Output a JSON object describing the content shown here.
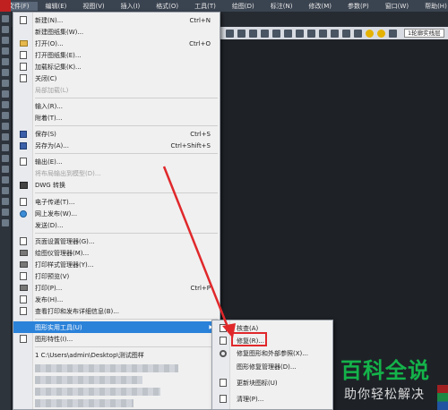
{
  "menubar": {
    "items": [
      "文件(F)",
      "编辑(E)",
      "视图(V)",
      "插入(I)",
      "格式(O)",
      "工具(T)",
      "绘图(D)",
      "标注(N)",
      "修改(M)",
      "参数(P)",
      "窗口(W)",
      "帮助(H)"
    ]
  },
  "toolbar": {
    "linetype_combo": "1轮廓实线层"
  },
  "file_menu": {
    "items": [
      {
        "label": "新建(N)...",
        "shortcut": "Ctrl+N",
        "icon": "new-page-icon"
      },
      {
        "label": "新建图纸集(W)...",
        "shortcut": "",
        "icon": ""
      },
      {
        "label": "打开(O)...",
        "shortcut": "Ctrl+O",
        "icon": "open-folder-icon"
      },
      {
        "label": "打开图纸集(E)...",
        "shortcut": "",
        "icon": "open-sheetset-icon"
      },
      {
        "label": "加载标记集(K)...",
        "shortcut": "",
        "icon": "markup-set-icon"
      },
      {
        "label": "关闭(C)",
        "shortcut": "",
        "icon": "close-file-icon"
      },
      {
        "label": "局部加载(L)",
        "shortcut": "",
        "icon": "",
        "disabled": true
      },
      {
        "label": "输入(R)...",
        "shortcut": "",
        "icon": ""
      },
      {
        "label": "附着(T)...",
        "shortcut": "",
        "icon": ""
      },
      {
        "label": "保存(S)",
        "shortcut": "Ctrl+S",
        "icon": "save-disk-icon"
      },
      {
        "label": "另存为(A)...",
        "shortcut": "Ctrl+Shift+S",
        "icon": "save-as-icon"
      },
      {
        "label": "输出(E)...",
        "shortcut": "",
        "icon": "export-icon"
      },
      {
        "label": "将布局输出到模型(D)...",
        "shortcut": "",
        "icon": "",
        "disabled": true
      },
      {
        "label": "DWG 转换",
        "shortcut": "",
        "icon": "dwg-convert-icon"
      },
      {
        "label": "电子传递(T)...",
        "shortcut": "",
        "icon": "etransmit-icon"
      },
      {
        "label": "网上发布(W)...",
        "shortcut": "",
        "icon": "web-publish-icon"
      },
      {
        "label": "发送(D)...",
        "shortcut": "",
        "icon": ""
      },
      {
        "label": "页面设置管理器(G)...",
        "shortcut": "",
        "icon": "page-setup-icon"
      },
      {
        "label": "绘图仪管理器(M)...",
        "shortcut": "",
        "icon": "plotter-icon"
      },
      {
        "label": "打印样式管理器(Y)...",
        "shortcut": "",
        "icon": "plot-style-icon"
      },
      {
        "label": "打印预览(V)",
        "shortcut": "",
        "icon": "print-preview-icon"
      },
      {
        "label": "打印(P)...",
        "shortcut": "Ctrl+P",
        "icon": "print-icon"
      },
      {
        "label": "发布(H)...",
        "shortcut": "",
        "icon": "publish-icon"
      },
      {
        "label": "查看打印和发布详细信息(B)...",
        "shortcut": "",
        "icon": "plot-details-icon"
      },
      {
        "label": "图形实用工具(U)",
        "shortcut": "",
        "icon": "",
        "submenu": true
      },
      {
        "label": "图形特性(I)...",
        "shortcut": "",
        "icon": "drawing-properties-icon"
      },
      {
        "label": "1 C:\\Users\\admin\\Desktop\\测试图样",
        "shortcut": "",
        "icon": ""
      }
    ]
  },
  "submenu": {
    "items": [
      {
        "label": "核查(A)",
        "icon": "audit-icon"
      },
      {
        "label": "修复(R)...",
        "icon": "recover-icon"
      },
      {
        "label": "修复图形和外部参照(X)...",
        "icon": "recover-xref-icon"
      },
      {
        "label": "图形修复管理器(D)...",
        "icon": "recovery-manager-icon"
      },
      {
        "label": "更新块图标(U)",
        "icon": "update-block-icon"
      },
      {
        "label": "清理(P)...",
        "icon": "purge-icon"
      }
    ]
  },
  "watermark": {
    "line1": "百科全说",
    "line2": "助你轻松解决"
  },
  "colors": {
    "menubar": "#3a4350",
    "menu_bg": "#f0f0f0",
    "highlight": "#2b82d9",
    "annotation_red": "#e0282b",
    "watermark_green": "#14b34a"
  }
}
